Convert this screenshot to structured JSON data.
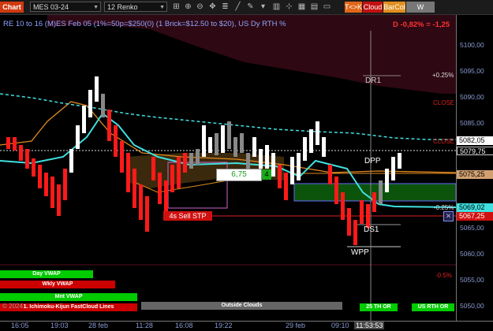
{
  "toolbar": {
    "chart_label": "Chart",
    "instrument": "MES 03-24",
    "bar_type": "12 Renko",
    "tk_label": "T<>K",
    "cloud_label": "Cloud",
    "barcol_label": "BarCol",
    "wvwap_label": "W VWAP"
  },
  "chart": {
    "title": "RE 10 to 16 (M)ES Feb 05 (1%=50p=$250(0) (1 Brick=$12.50 to $20), US Dy RTH %",
    "change": "D -0,82% = -1,25",
    "annotations": {
      "dr1": "DR1",
      "dpp": "DPP",
      "ds1": "DS1",
      "wpp": "WPP",
      "sell_stop": "4s  Sell STP",
      "position_qty": "6,75",
      "position_count": "4",
      "pos_pct": "+0.25%",
      "close_upper": "CLOSE",
      "close_lower": "CLOSE",
      "neg_pct": "-0.25%",
      "neg_pct2": "-0.5%"
    },
    "legend": {
      "day_vwap": "Day VWAP",
      "wkly_vwap": "Wkly VWAP",
      "mnt_vwap": "Mnt VWAP",
      "ichimoku": "1. Ichimoku-Kijun FastCloud Lines",
      "outside_clouds": "Outside Clouds",
      "status_left": "25 TH OR",
      "status_right": "US RTH OR"
    },
    "copyright": "© 2024"
  },
  "price_axis": {
    "labels": [
      "5100,00",
      "5095,00",
      "5090,00",
      "5085,00",
      "5065,00",
      "5060,00",
      "5055,00",
      "5050,00"
    ],
    "badges": {
      "p1": "5082,05",
      "p2": "5079,75",
      "p3": "5075,25",
      "p4": "5069,02",
      "p5": "5067,25"
    }
  },
  "time_axis": {
    "labels": [
      "16:05",
      "19:03",
      "28 feb",
      "11:28",
      "16:08",
      "19:22",
      "29 feb",
      "09:10",
      "11:53:53"
    ]
  },
  "colors": {
    "bull": "#ffffff",
    "bear": "#ff1a1a",
    "kijun": "#40e0e0",
    "orange": "#e08a20",
    "cloud_green": "#0d5c0d",
    "cloud_red": "#5a0a1a"
  }
}
